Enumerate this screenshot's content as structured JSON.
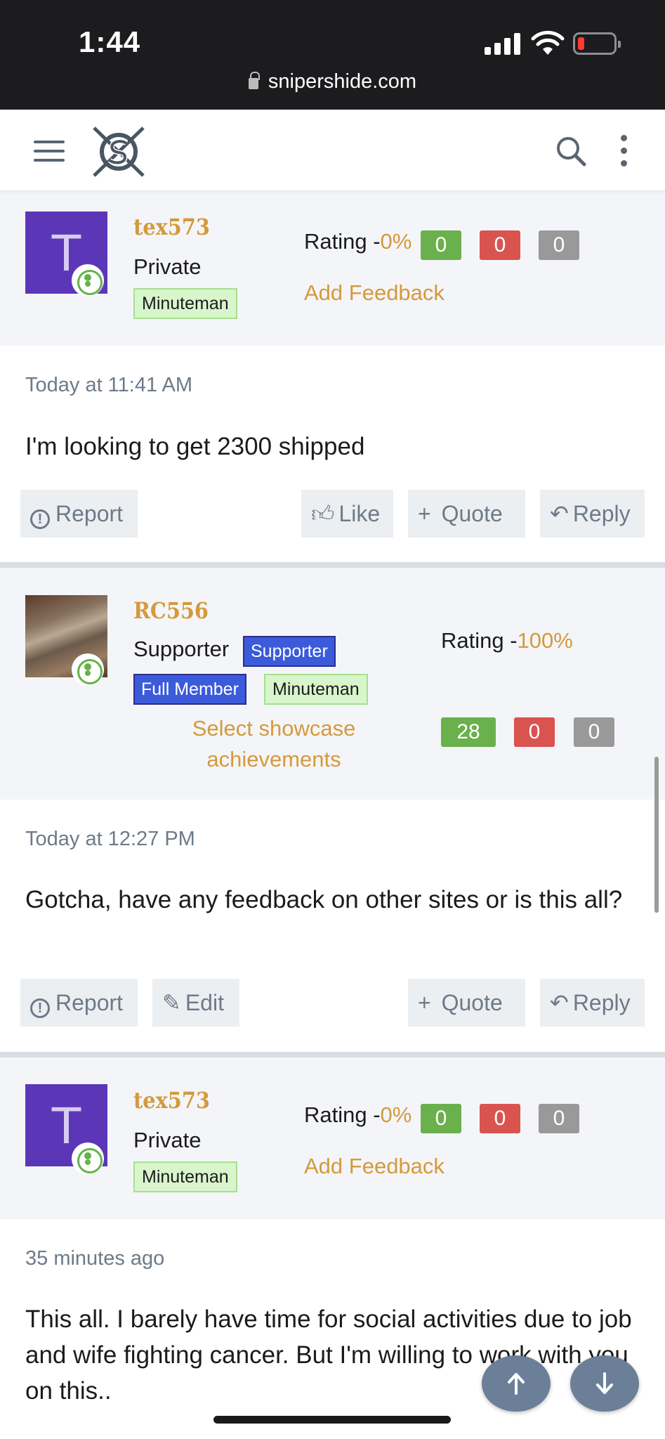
{
  "status_bar": {
    "time": "1:44",
    "url": "snipershide.com"
  },
  "nav": {
    "menu_icon": "hamburger-icon",
    "logo": "snipershide-logo",
    "search_icon": "search-icon",
    "more_icon": "more-vertical-icon"
  },
  "colors": {
    "accent": "#d49a3c",
    "avatar_purple": "#5b37b8",
    "badge_green_bg": "#d8f5cc",
    "badge_blue_bg": "#3b5bdb",
    "count_green": "#6ab04c",
    "count_red": "#d9534f",
    "count_gray": "#999999",
    "muted": "#6d7a88"
  },
  "posts": [
    {
      "username": "tex573",
      "avatar_letter": "T",
      "title": "Private",
      "badges": [
        "Minuteman"
      ],
      "rating_label": "Rating -",
      "rating_pct": "0%",
      "counts": [
        "0",
        "0",
        "0"
      ],
      "feedback_link": "Add Feedback",
      "timestamp": "Today at 11:41 AM",
      "message": "I'm looking to get 2300 shipped",
      "actions": {
        "report": "Report",
        "like": "Like",
        "quote": "Quote",
        "reply": "Reply"
      }
    },
    {
      "username": "RC556",
      "title": "Supporter",
      "badges": [
        "Supporter",
        "Full Member",
        "Minuteman"
      ],
      "showcase": "Select showcase achievements",
      "rating_label": "Rating -",
      "rating_pct": "100%",
      "counts": [
        "28",
        "0",
        "0"
      ],
      "timestamp": "Today at 12:27 PM",
      "message": "Gotcha, have any feedback on other sites or is this all?",
      "actions": {
        "report": "Report",
        "edit": "Edit",
        "quote": "Quote",
        "reply": "Reply"
      }
    },
    {
      "username": "tex573",
      "avatar_letter": "T",
      "title": "Private",
      "badges": [
        "Minuteman"
      ],
      "rating_label": "Rating -",
      "rating_pct": "0%",
      "counts": [
        "0",
        "0",
        "0"
      ],
      "feedback_link": "Add Feedback",
      "timestamp": "35 minutes ago",
      "message": "This all. I barely have time for social activities due to job and wife fighting cancer. But I'm willing to work with you on this.."
    }
  ],
  "fab": {
    "up_icon": "arrow-up-icon",
    "down_icon": "arrow-down-icon"
  }
}
